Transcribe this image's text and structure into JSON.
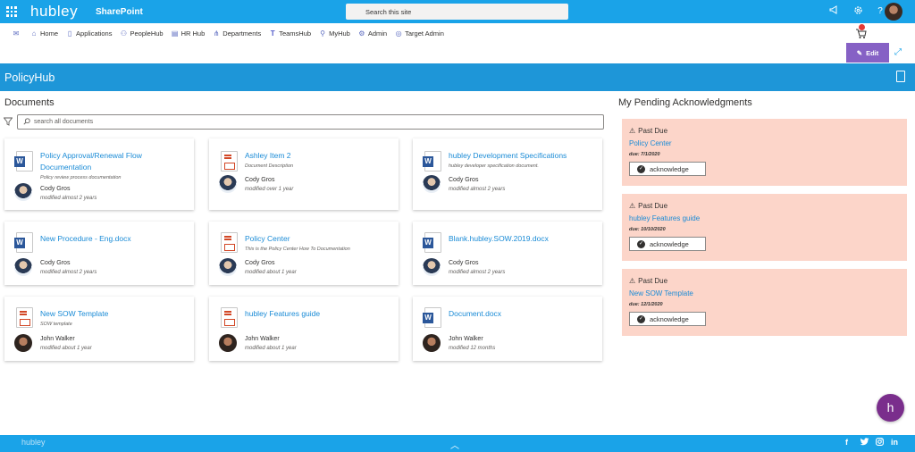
{
  "topbar": {
    "brand": "hubley",
    "app_label": "SharePoint",
    "search_placeholder": "Search this site"
  },
  "nav": [
    {
      "label": "Home"
    },
    {
      "label": "Applications"
    },
    {
      "label": "PeopleHub"
    },
    {
      "label": "HR Hub"
    },
    {
      "label": "Departments"
    },
    {
      "label": "TeamsHub"
    },
    {
      "label": "MyHub"
    },
    {
      "label": "Admin"
    },
    {
      "label": "Target Admin"
    }
  ],
  "edit_label": "Edit",
  "page_title": "PolicyHub",
  "documents": {
    "title": "Documents",
    "search_placeholder": "search all documents",
    "cards": [
      {
        "title": "Policy Approval/Renewal Flow Documentation",
        "description": "Policy review process documentation",
        "author": "Cody Gros",
        "modified": "modified almost 2 years",
        "filetype": "word-icon"
      },
      {
        "title": "Ashley Item 2",
        "description": "Document Description",
        "author": "Cody Gros",
        "modified": "modified over 1 year",
        "filetype": "pdf-icon"
      },
      {
        "title": "hubley Development Specifications",
        "description": "hubley developer specification document.",
        "author": "Cody Gros",
        "modified": "modified almost 2 years",
        "filetype": "word-icon"
      },
      {
        "title": "New Procedure - Eng.docx",
        "description": "",
        "author": "Cody Gros",
        "modified": "modified almost 2 years",
        "filetype": "word-icon"
      },
      {
        "title": "Policy Center",
        "description": "This is the Policy Center How To Documentation",
        "author": "Cody Gros",
        "modified": "modified about 1 year",
        "filetype": "pdf-icon"
      },
      {
        "title": "Blank.hubley.SOW.2019.docx",
        "description": "",
        "author": "Cody Gros",
        "modified": "modified almost 2 years",
        "filetype": "word-icon"
      },
      {
        "title": "New SOW Template",
        "description": "SOW template",
        "author": "John Walker",
        "modified": "modified about 1 year",
        "filetype": "pdf-icon"
      },
      {
        "title": "hubley Features guide",
        "description": "",
        "author": "John Walker",
        "modified": "modified about 1 year",
        "filetype": "pdf-icon"
      },
      {
        "title": "Document.docx",
        "description": "",
        "author": "John Walker",
        "modified": "modified 12 months",
        "filetype": "word-icon"
      }
    ]
  },
  "pending": {
    "title": "My Pending Acknowledgments",
    "status_label": "Past Due",
    "button_label": "acknowledge",
    "items": [
      {
        "name": "Policy Center",
        "due": "due: 7/1/2020"
      },
      {
        "name": "hubley Features guide",
        "due": "due: 10/10/2020"
      },
      {
        "name": "New SOW Template",
        "due": "due: 12/1/2020"
      }
    ]
  },
  "fab_label": "h",
  "footer": {
    "brand": "hubley",
    "social": [
      "f",
      "t",
      "ig",
      "in"
    ]
  },
  "colors": {
    "brand_blue": "#1aa3e8",
    "header_blue": "#1e96d8",
    "edit_purple": "#8661c5",
    "pending_bg": "#fcd5c9",
    "link_blue": "#1a8bd6",
    "fab_purple": "#7a2e8c"
  }
}
